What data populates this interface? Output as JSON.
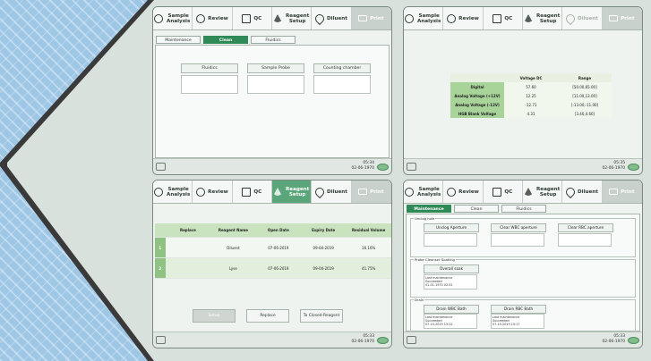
{
  "nav": {
    "sample_analysis": "Sample Analysis",
    "review": "Review",
    "qc": "QC",
    "reagent_setup": "Reagent Setup",
    "diluent": "Diluent",
    "print": "Print"
  },
  "clock": {
    "p1_time": "05:34",
    "p2_time": "05:35",
    "p3_time": "05:33",
    "p4_time": "05:33",
    "date": "02-06-1970"
  },
  "clean_panel": {
    "tabs": [
      "Maintenance",
      "Clean",
      "Fluidics"
    ],
    "buttons": [
      "Fluidics",
      "Sample Probe",
      "Counting chamber"
    ]
  },
  "voltage_panel": {
    "headers": [
      "",
      "Voltage DC",
      "Range"
    ],
    "rows": [
      [
        "Digital",
        "57.60",
        "[50.00,65.00]"
      ],
      [
        "Analog Voltage (+12V)",
        "12.25",
        "[11.00,13.00]"
      ],
      [
        "Analog Voltage (-12V)",
        "-12.71",
        "[-13.00,-11.00]"
      ],
      [
        "HGB Blank Voltage",
        "4.31",
        "[3.40,4.60]"
      ]
    ]
  },
  "reagent_panel": {
    "headers": [
      "",
      "Replace",
      "Reagent Name",
      "Open Date",
      "Expiry Date",
      "Residual Volume"
    ],
    "rows": [
      [
        "1",
        "",
        "Diluent",
        "07-06-2019",
        "09-04-2019",
        "16.16%"
      ],
      [
        "2",
        "",
        "Lyse",
        "07-06-2019",
        "09-04-2019",
        "41.75%"
      ]
    ],
    "buttons": [
      "Setup",
      "Replace",
      "To Closed-Reagent"
    ]
  },
  "maint_panel": {
    "tabs": [
      "Maintenance",
      "Clean",
      "Fluidics"
    ],
    "unclog_title": "Unclog hole",
    "unclog_buttons": [
      "Unclog Aperture",
      "Clear WBC aperture",
      "Clear RBC aperture"
    ],
    "probe_title": "Probe Cleanser Soaking",
    "probe_button": "Overall soak",
    "probe_status": [
      "Last maintenance",
      "Succeeded",
      "01-01-1970 02:51"
    ],
    "drain_title": "Drain",
    "drain_buttons": [
      "Drain WBC Bath",
      "Drain RBC Bath"
    ],
    "drain_wbc_status": [
      "Last maintenance",
      "Succeeded",
      "07-15-2019 15:22"
    ],
    "drain_rbc_status": [
      "Last maintenance",
      "Succeeded",
      "07-15-2019 15:17"
    ]
  }
}
